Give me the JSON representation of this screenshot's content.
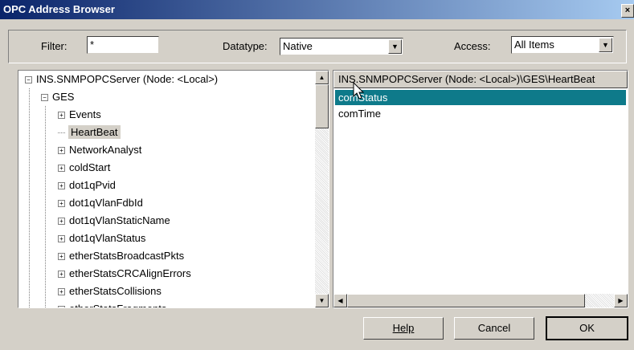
{
  "window": {
    "title": "OPC Address Browser",
    "close_glyph": "×"
  },
  "filter_bar": {
    "filter_label": "Filter:",
    "filter_value": "*",
    "datatype_label": "Datatype:",
    "datatype_value": "Native",
    "access_label": "Access:",
    "access_value": "All Items"
  },
  "tree": {
    "root": "INS.SNMPOPCServer (Node: <Local>)",
    "group": "GES",
    "items": [
      {
        "label": "Events",
        "expandable": true
      },
      {
        "label": "HeartBeat",
        "expandable": false,
        "selected": true
      },
      {
        "label": "NetworkAnalyst",
        "expandable": true
      },
      {
        "label": "coldStart",
        "expandable": true
      },
      {
        "label": "dot1qPvid",
        "expandable": true
      },
      {
        "label": "dot1qVlanFdbId",
        "expandable": true
      },
      {
        "label": "dot1qVlanStaticName",
        "expandable": true
      },
      {
        "label": "dot1qVlanStatus",
        "expandable": true
      },
      {
        "label": "etherStatsBroadcastPkts",
        "expandable": true
      },
      {
        "label": "etherStatsCRCAlignErrors",
        "expandable": true
      },
      {
        "label": "etherStatsCollisions",
        "expandable": true
      },
      {
        "label": "etherStatsFragments",
        "expandable": true
      }
    ]
  },
  "items_panel": {
    "header": "INS.SNMPOPCServer (Node: <Local>)\\GES\\HeartBeat",
    "items": [
      {
        "label": "comStatus",
        "selected": true
      },
      {
        "label": "comTime",
        "selected": false
      }
    ]
  },
  "buttons": {
    "help": "Help",
    "cancel": "Cancel",
    "ok": "OK"
  },
  "colors": {
    "selection": "#0e7a8a",
    "title_start": "#0a246a",
    "title_end": "#a6caf0",
    "face": "#d4d0c8"
  }
}
